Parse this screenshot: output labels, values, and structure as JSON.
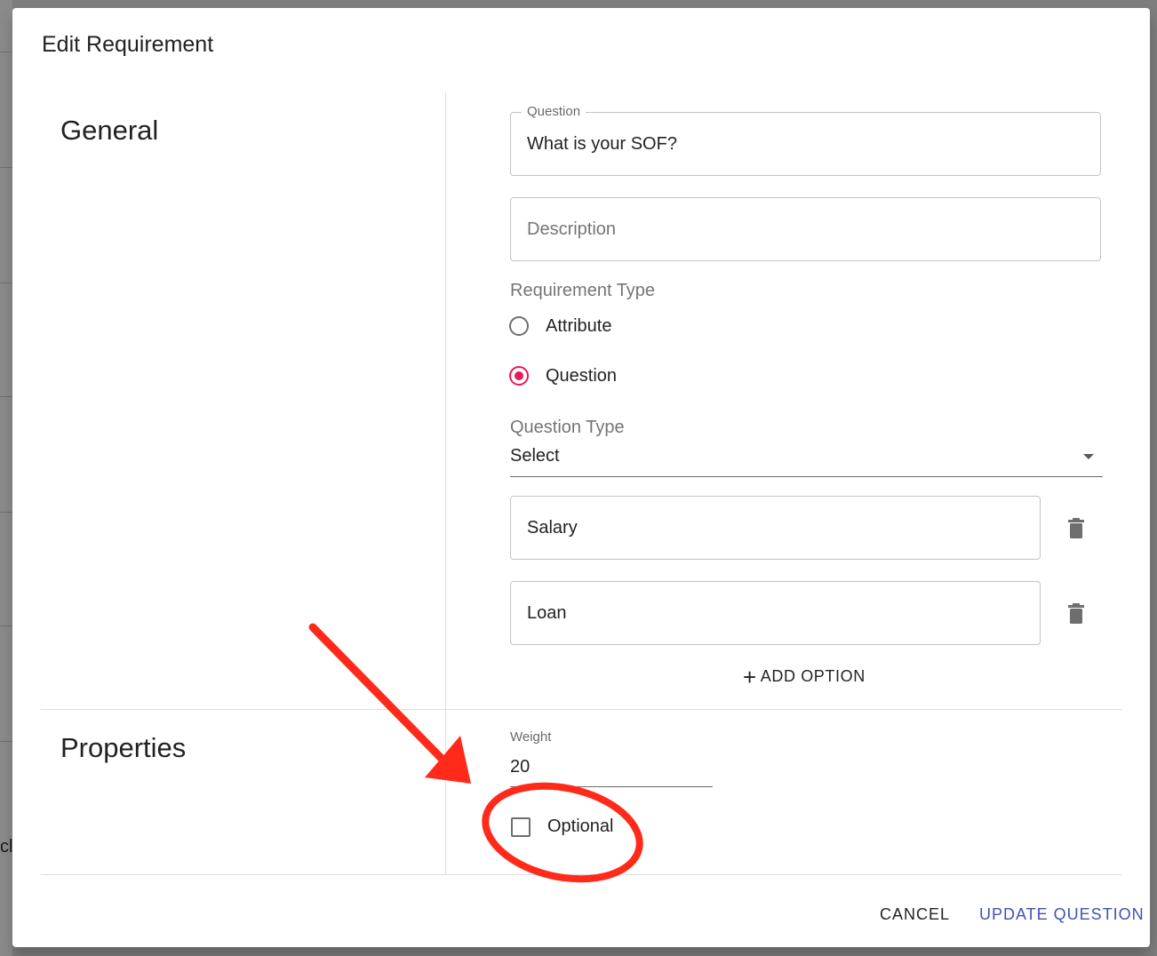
{
  "background": {
    "partial_text": "cl"
  },
  "dialog": {
    "title": "Edit Requirement",
    "general": {
      "heading": "General",
      "question": {
        "legend": "Question",
        "value": "What is your SOF?"
      },
      "description": {
        "placeholder": "Description"
      },
      "requirement_type": {
        "label": "Requirement Type",
        "options": [
          {
            "label": "Attribute",
            "checked": false
          },
          {
            "label": "Question",
            "checked": true
          }
        ]
      },
      "question_type": {
        "label": "Question Type",
        "value": "Select"
      },
      "options": [
        "Salary",
        "Loan"
      ],
      "add_option_label": "ADD OPTION",
      "add_option_icon": "plus-icon",
      "delete_icon": "trash-icon"
    },
    "properties": {
      "heading": "Properties",
      "weight": {
        "label": "Weight",
        "value": "20"
      },
      "optional": {
        "label": "Optional",
        "checked": false
      }
    },
    "actions": {
      "cancel": "CANCEL",
      "update": "UPDATE QUESTION"
    }
  },
  "annotation": {
    "color": "#ff2a1a",
    "type": "red arrow pointing to circled Optional checkbox"
  },
  "colors": {
    "accent": "#e8185b",
    "primary_button": "#3f51b5"
  }
}
